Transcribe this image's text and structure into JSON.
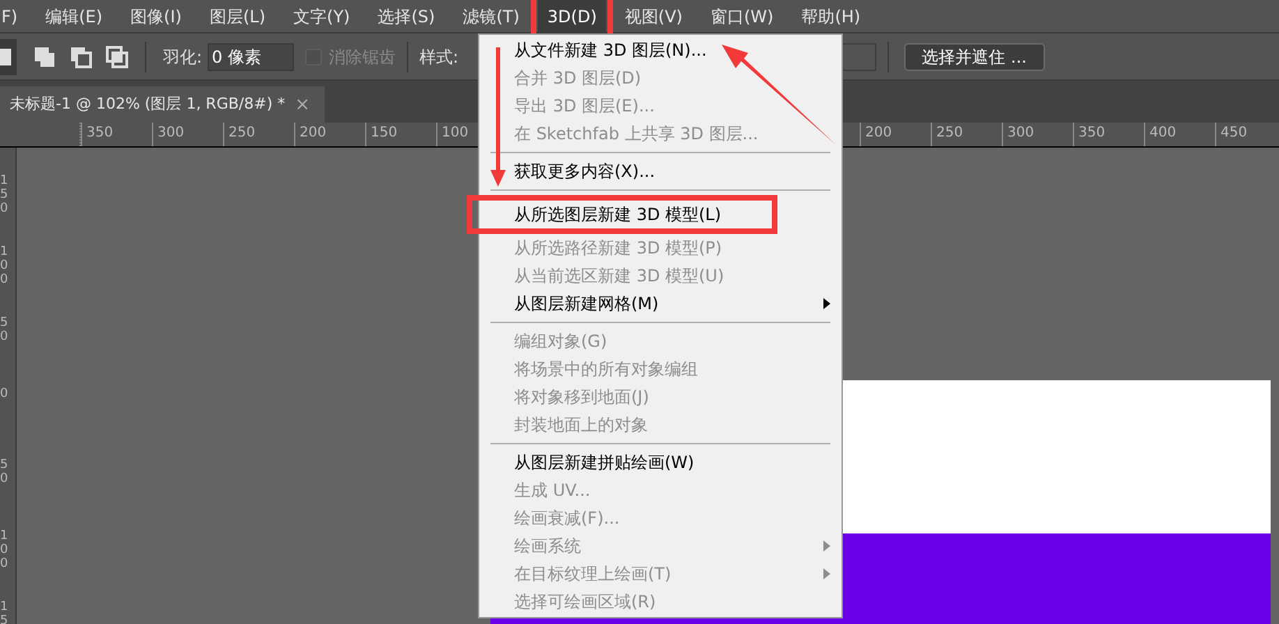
{
  "menu_bar": [
    {
      "label": "F)",
      "selected": false
    },
    {
      "label": "编辑(E)",
      "selected": false
    },
    {
      "label": "图像(I)",
      "selected": false
    },
    {
      "label": "图层(L)",
      "selected": false
    },
    {
      "label": "文字(Y)",
      "selected": false
    },
    {
      "label": "选择(S)",
      "selected": false
    },
    {
      "label": "滤镜(T)",
      "selected": false
    },
    {
      "label": "3D(D)",
      "selected": true
    },
    {
      "label": "视图(V)",
      "selected": false
    },
    {
      "label": "窗口(W)",
      "selected": false
    },
    {
      "label": "帮助(H)",
      "selected": false
    }
  ],
  "options_bar": {
    "feather_label": "羽化:",
    "feather_value": "0 像素",
    "antialias": {
      "label": "消除锯齿",
      "checked": false,
      "disabled": true
    },
    "style_label": "样式:",
    "select_mask_button": "选择并遮住 ..."
  },
  "document_tab": {
    "title": "未标题-1 @ 102% (图层 1, RGB/8#) *",
    "close": "×"
  },
  "ruler": {
    "left_labels": [
      "350",
      "300",
      "250",
      "200",
      "150",
      "100"
    ],
    "right_labels": [
      "200",
      "250",
      "300",
      "350",
      "400",
      "450"
    ],
    "vertical_labels": [
      "150",
      "100",
      "50",
      "0",
      "50",
      "100",
      "15"
    ]
  },
  "menu": {
    "groups": [
      [
        {
          "label": "从文件新建 3D 图层(N)...",
          "disabled": false,
          "submenu": false,
          "highlighted": false
        },
        {
          "label": "合并 3D 图层(D)",
          "disabled": true,
          "submenu": false,
          "highlighted": false
        },
        {
          "label": "导出 3D 图层(E)...",
          "disabled": true,
          "submenu": false,
          "highlighted": false
        },
        {
          "label": "在 Sketchfab 上共享 3D 图层...",
          "disabled": true,
          "submenu": false,
          "highlighted": false
        }
      ],
      [
        {
          "label": "获取更多内容(X)...",
          "disabled": false,
          "submenu": false,
          "highlighted": false
        }
      ],
      [
        {
          "label": "从所选图层新建 3D 模型(L)",
          "disabled": false,
          "submenu": false,
          "highlighted": true
        },
        {
          "label": "从所选路径新建 3D 模型(P)",
          "disabled": true,
          "submenu": false,
          "highlighted": false
        },
        {
          "label": "从当前选区新建 3D 模型(U)",
          "disabled": true,
          "submenu": false,
          "highlighted": false
        },
        {
          "label": "从图层新建网格(M)",
          "disabled": false,
          "submenu": true,
          "highlighted": false
        }
      ],
      [
        {
          "label": "编组对象(G)",
          "disabled": true,
          "submenu": false,
          "highlighted": false
        },
        {
          "label": "将场景中的所有对象编组",
          "disabled": true,
          "submenu": false,
          "highlighted": false
        },
        {
          "label": "将对象移到地面(J)",
          "disabled": true,
          "submenu": false,
          "highlighted": false
        },
        {
          "label": "封装地面上的对象",
          "disabled": true,
          "submenu": false,
          "highlighted": false
        }
      ],
      [
        {
          "label": "从图层新建拼贴绘画(W)",
          "disabled": false,
          "submenu": false,
          "highlighted": false
        },
        {
          "label": "生成 UV...",
          "disabled": true,
          "submenu": false,
          "highlighted": false
        },
        {
          "label": "绘画衰减(F)...",
          "disabled": true,
          "submenu": false,
          "highlighted": false
        },
        {
          "label": "绘画系统",
          "disabled": true,
          "submenu": true,
          "highlighted": false
        },
        {
          "label": "在目标纹理上绘画(T)",
          "disabled": true,
          "submenu": true,
          "highlighted": false
        },
        {
          "label": "选择可绘画区域(R)",
          "disabled": true,
          "submenu": false,
          "highlighted": false
        }
      ]
    ]
  }
}
